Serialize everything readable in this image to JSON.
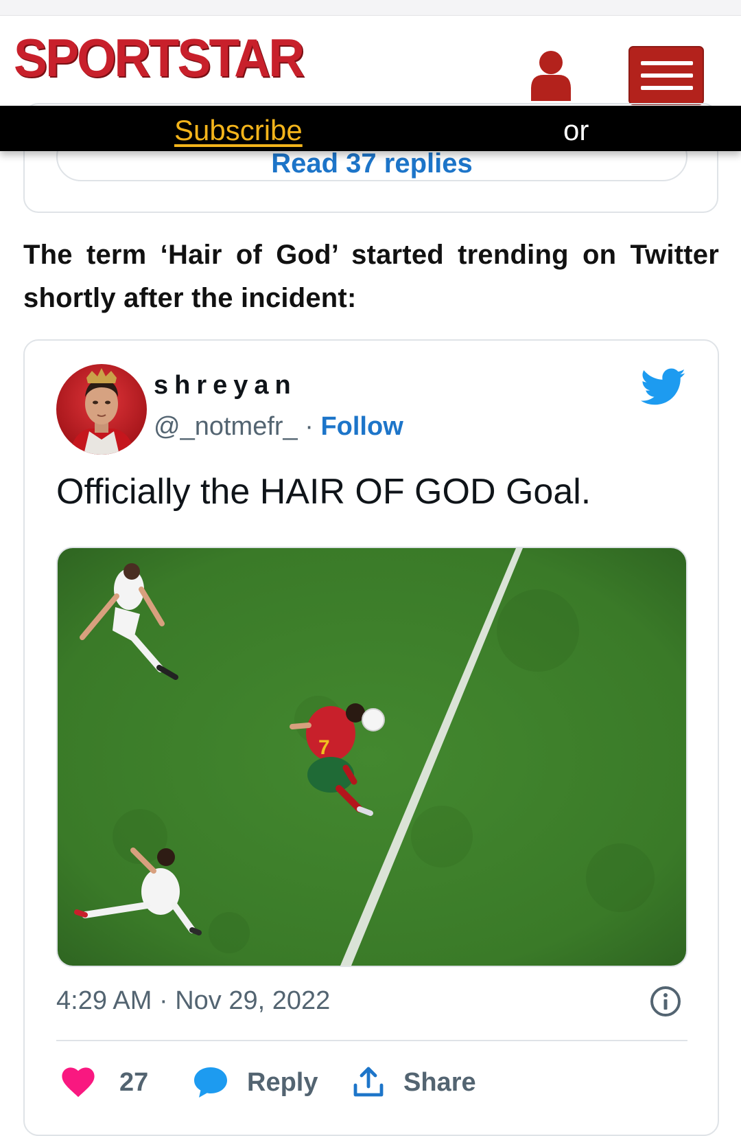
{
  "header": {
    "logo_text": "SPORTSTAR",
    "brand_color": "#c8202b",
    "subscribe_label": "Subscribe",
    "or_text": "or",
    "icons": [
      "user-icon",
      "hamburger-menu-icon"
    ]
  },
  "previous_embed": {
    "button_label": "Read 37 replies"
  },
  "article": {
    "paragraph": "The term ‘Hair of God’ started trending on Twitter shortly after the incident:"
  },
  "tweet": {
    "author_name": "shreyan",
    "handle": "@_notmefr_",
    "separator": "·",
    "follow_label": "Follow",
    "text": "Officially the HAIR OF GOD Goal.",
    "timestamp": "4:29 AM · Nov 29, 2022",
    "likes_count": "27",
    "reply_label": "Reply",
    "share_label": "Share",
    "accent_color": "#1d9bf0",
    "like_color": "#f91880",
    "icons": [
      "twitter-bird-icon",
      "info-icon",
      "heart-icon",
      "reply-bubble-icon",
      "share-icon"
    ]
  }
}
